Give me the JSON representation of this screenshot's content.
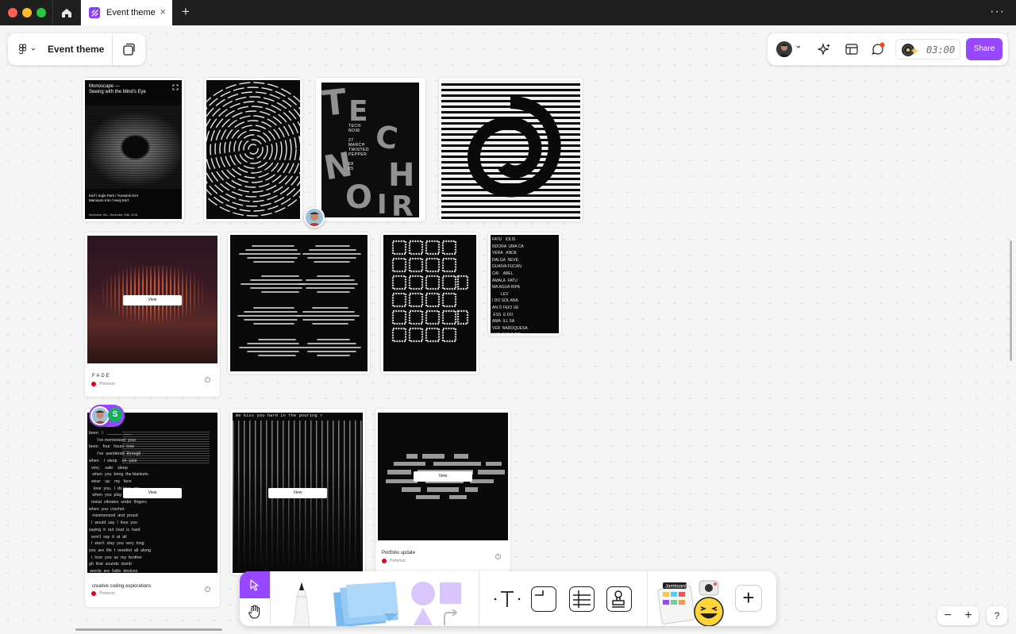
{
  "window": {
    "tab_title": "Event theme",
    "tab_close": "×",
    "new_tab": "+",
    "more": "···"
  },
  "file_bar": {
    "file_name": "Event theme"
  },
  "right_bar": {
    "timer": "03:00",
    "share_label": "Share",
    "accent_color": "#9747ff"
  },
  "cards": {
    "monoscape": {
      "title": "Monoscape —\nSeeing with the Mind's Eye",
      "credits": "Kiof / Sujin Park / Yunseok Kim\nMansoon Kim / Heoj Kert",
      "dates": "December, 6th – December, 20th, 2015"
    },
    "technoir": {
      "lines": "TECH\nNOIR\n\n27\nMARCH\nTWISTED\nPEPPER\n\n€8\n€5"
    },
    "fade": {
      "view_label": "View",
      "title": "FADE",
      "source": "Pinterest"
    },
    "words": {
      "text": "FATU   IOLIS\nNDORA  UMA CA\nVERA   ANDE\nDALGA  NEVE\nGUAIVA FUCAN\nCAI    ABEL\nAMALA  FATU\nMA AGUA RIPA\n        LEV\nI DO SOL ANA\nAN O FEIO UE\n ESS  E DO\nAMA  ILL SA\nVER  BAROQUESA\nLUZ  SAE E DO\nA DOMINA UMA\n  JO  VESTE RINA\n  A MUNDO DE JACA\n  FAMEI  AO\n  DE BRUNE POULAIN\n  NUA  AMO CABECA\nTE AMOR  MONSTROS"
    },
    "creative": {
      "view_label": "View",
      "title": "creative coding explorations",
      "source": "Pinterest",
      "poem": "been   I    ______  ___\n       I've memorized  your\nbeen    four   hours  now\n       I've  wandered  through\nwhen    I  sleep    on  your\n  very     safe    sleep\n   when  you  bring  the blankets\n  wear    up    my   face\n    love  you,  I  do love  you\n   when  you  play  guitar\n  metal  vibrates  under  fingers\nwhen  you  crochet\n   mesmerized  and  proud\n  I  would  say  I  love  you\nsaying  it  out  loud  is  hard\n  won't  say  it  at  all\n  I  won't  stay  you  very  long\nyou  are  life  I  needed  all  along\n  I  love  you  as  my  brother\ngh  that  sounds  dumb\n words  are  futile  devices"
    },
    "matrix": {
      "view_label": "View",
      "header": "me  kiss  you  hard  in  the  pouring  r"
    },
    "portfolio": {
      "view_label": "View",
      "title": "Portfolio update",
      "source": "Pinterest"
    }
  },
  "collaborators": {
    "s_initial": "S"
  },
  "dock": {
    "stamp_label": "Jamboard"
  },
  "zoom": {
    "out": "−",
    "in": "+",
    "help": "?"
  }
}
